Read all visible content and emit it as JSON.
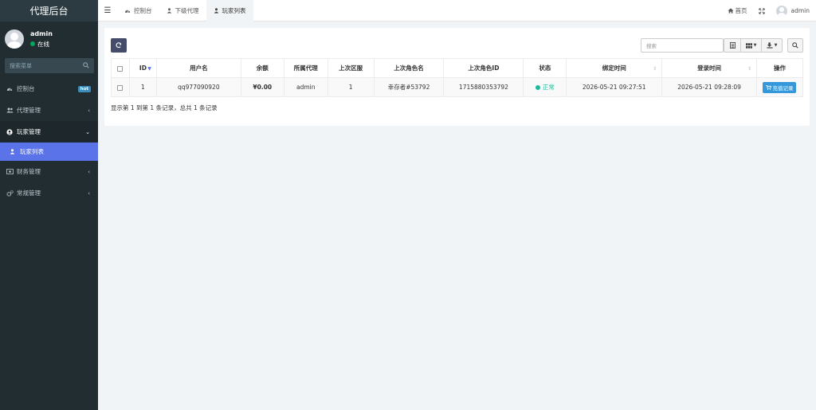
{
  "app": {
    "title": "代理后台"
  },
  "user": {
    "name": "admin",
    "status": "在线"
  },
  "sidebar": {
    "search_placeholder": "搜索菜单",
    "items": [
      {
        "label": "控制台",
        "icon": "dashboard-icon",
        "badge": "hot"
      },
      {
        "label": "代理管理",
        "icon": "users-icon"
      },
      {
        "label": "玩家管理",
        "icon": "user-circle-icon"
      },
      {
        "label": "玩家列表",
        "icon": "user-icon"
      },
      {
        "label": "财务管理",
        "icon": "money-icon"
      },
      {
        "label": "常规管理",
        "icon": "cogs-icon"
      }
    ]
  },
  "topbar": {
    "tabs": [
      {
        "label": "控制台",
        "icon": "dashboard-icon"
      },
      {
        "label": "下级代理",
        "icon": "user-icon"
      },
      {
        "label": "玩家列表",
        "icon": "user-icon"
      }
    ],
    "home_label": "首页",
    "user_name": "admin"
  },
  "toolbar": {
    "search_placeholder": "搜索"
  },
  "table": {
    "columns": [
      "ID",
      "用户名",
      "余额",
      "所属代理",
      "上次区服",
      "上次角色名",
      "上次角色ID",
      "状态",
      "绑定时间",
      "登录时间",
      "操作"
    ],
    "rows": [
      {
        "id": "1",
        "username": "qq977090920",
        "balance": "¥0.00",
        "agent": "admin",
        "last_server": "1",
        "last_role_name": "幸存者#53792",
        "last_role_id": "1715880353792",
        "status": "正常",
        "bind_time": "2026-05-21 09:27:51",
        "login_time": "2026-05-21 09:28:09",
        "action": "充值记录"
      }
    ]
  },
  "pagination": {
    "info": "显示第 1 到第 1 条记录，总共 1 条记录"
  },
  "colors": {
    "sidebar_bg": "#222d32",
    "accent": "#5b73e8",
    "status_ok": "#18bc9c",
    "money": "#e74c3c",
    "action_btn": "#3498db"
  }
}
